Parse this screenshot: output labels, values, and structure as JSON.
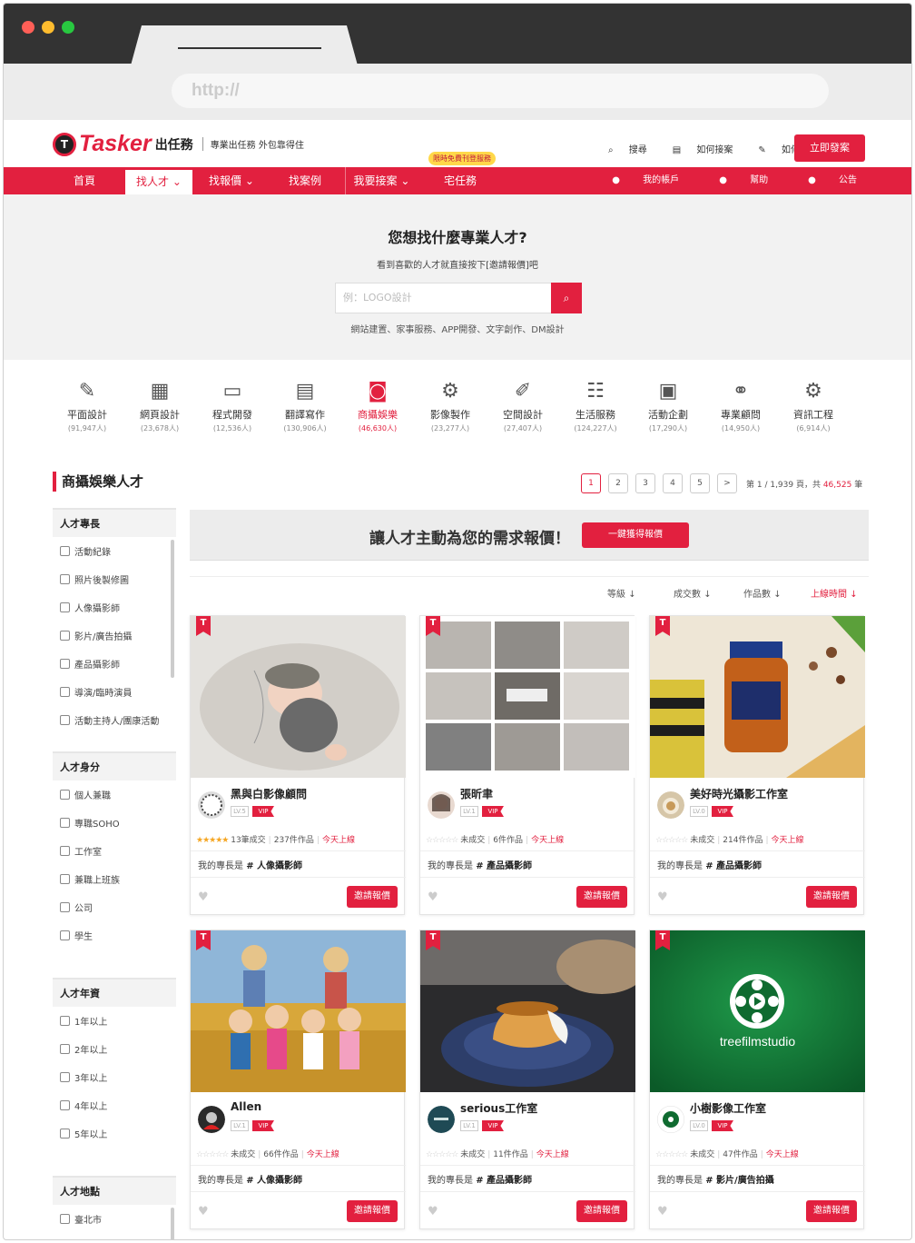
{
  "browser": {
    "url_placeholder": "http://"
  },
  "header": {
    "logo_text": "Tasker",
    "logo_cn": "出任務",
    "slogan": "專業出任務 外包靠得住",
    "links": [
      "搜尋",
      "如何接案",
      "如何發案"
    ],
    "post_button": "立即發案"
  },
  "nav": {
    "items": [
      "首頁",
      "找人才",
      "找報價",
      "找案例",
      "我要接案",
      "宅任務"
    ],
    "promo_badge": "限時免費刊登服務",
    "right": [
      "我的帳戶",
      "幫助",
      "公告"
    ]
  },
  "hero": {
    "title": "您想找什麼專業人才?",
    "subtitle": "看到喜歡的人才就直接按下[邀請報價]吧",
    "search_placeholder": "例：LOGO設計",
    "tags": "網站建置、家事服務、APP開發、文字創作、DM設計"
  },
  "categories": [
    {
      "name": "平面設計",
      "count": "(91,947人)",
      "icon": "pencil-ruler-icon"
    },
    {
      "name": "網頁設計",
      "count": "(23,678人)",
      "icon": "webpage-layout-icon"
    },
    {
      "name": "程式開發",
      "count": "(12,536人)",
      "icon": "code-monitor-icon"
    },
    {
      "name": "翻譯寫作",
      "count": "(130,906人)",
      "icon": "document-icon"
    },
    {
      "name": "商攝娛樂",
      "count": "(46,630人)",
      "icon": "camera-icon",
      "active": true
    },
    {
      "name": "影像製作",
      "count": "(23,277人)",
      "icon": "film-camera-icon"
    },
    {
      "name": "空間設計",
      "count": "(27,407人)",
      "icon": "interior-design-icon"
    },
    {
      "name": "生活服務",
      "count": "(124,227人)",
      "icon": "clipboard-icon"
    },
    {
      "name": "活動企劃",
      "count": "(17,290人)",
      "icon": "presentation-icon"
    },
    {
      "name": "專業顧問",
      "count": "(14,950人)",
      "icon": "handshake-icon"
    },
    {
      "name": "資訊工程",
      "count": "(6,914人)",
      "icon": "engineering-icon"
    }
  ],
  "section": {
    "title": "商攝娛樂人才"
  },
  "pager": {
    "pages": [
      "1",
      "2",
      "3",
      "4",
      "5",
      ">"
    ],
    "info_prefix": "第 1 / 1,939 頁，共 ",
    "total": "46,525",
    "info_suffix": " 筆"
  },
  "filters": [
    {
      "title": "人才專長",
      "items": [
        "活動紀錄",
        "照片後製修圖",
        "人像攝影師",
        "影片/廣告拍攝",
        "產品攝影師",
        "導演/臨時演員",
        "活動主持人/團康活動"
      ]
    },
    {
      "title": "人才身分",
      "items": [
        "個人兼職",
        "專職SOHO",
        "工作室",
        "兼職上班族",
        "公司",
        "學生"
      ]
    },
    {
      "title": "人才年資",
      "items": [
        "1年以上",
        "2年以上",
        "3年以上",
        "4年以上",
        "5年以上"
      ]
    },
    {
      "title": "人才地點",
      "items": [
        "臺北市"
      ]
    }
  ],
  "banner": {
    "text": "讓人才主動為您的需求報價！",
    "button": "一鍵獲得報價"
  },
  "sort": [
    "等級",
    "成交數",
    "作品數",
    "上線時間"
  ],
  "cards": [
    {
      "name": "黑與白影像顧問",
      "level": "LV.5",
      "vip": "VIP",
      "deals": "13筆成交",
      "works": "237件作品",
      "online": "今天上線",
      "spec_prefix": "我的專長是 ",
      "spec": "# 人像攝影師",
      "invite": "邀請報價",
      "rated": true
    },
    {
      "name": "張昕聿",
      "level": "LV.1",
      "vip": "VIP",
      "deals": "未成交",
      "works": "6件作品",
      "online": "今天上線",
      "spec_prefix": "我的專長是 ",
      "spec": "# 產品攝影師",
      "invite": "邀請報價",
      "rated": false
    },
    {
      "name": "美好時光攝影工作室",
      "level": "LV.0",
      "vip": "VIP",
      "deals": "未成交",
      "works": "214件作品",
      "online": "今天上線",
      "spec_prefix": "我的專長是 ",
      "spec": "# 產品攝影師",
      "invite": "邀請報價",
      "rated": false
    },
    {
      "name": "Allen",
      "level": "LV.1",
      "vip": "VIP",
      "deals": "未成交",
      "works": "66件作品",
      "online": "今天上線",
      "spec_prefix": "我的專長是 ",
      "spec": "# 人像攝影師",
      "invite": "邀請報價",
      "rated": false
    },
    {
      "name": "serious工作室",
      "level": "LV.1",
      "vip": "VIP",
      "deals": "未成交",
      "works": "11件作品",
      "online": "今天上線",
      "spec_prefix": "我的專長是 ",
      "spec": "# 產品攝影師",
      "invite": "邀請報價",
      "rated": false
    },
    {
      "name": "小樹影像工作室",
      "level": "LV.0",
      "vip": "VIP",
      "deals": "未成交",
      "works": "47件作品",
      "online": "今天上線",
      "spec_prefix": "我的專長是 ",
      "spec": "# 影片/廣告拍攝",
      "invite": "邀請報價",
      "rated": false
    }
  ],
  "card_ribbon": "T",
  "studio_logo_text": "treefilmstudio",
  "colors": {
    "accent": "#e2203f",
    "hero_bg": "#f2f2f2",
    "star": "#f5a623"
  }
}
